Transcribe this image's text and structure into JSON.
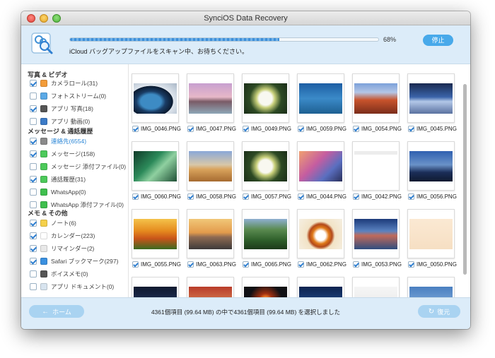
{
  "window": {
    "title": "SynciOS Data Recovery"
  },
  "header": {
    "progress_fraction": 0.68,
    "progress_text": "68%",
    "status": "iCloud バッグアップファイルをスキャン中、お待ちください。",
    "stop_label": "停止"
  },
  "sidebar": {
    "sections": [
      {
        "title": "写真 & ビデオ",
        "items": [
          {
            "label": "カメラロール(31)",
            "checked": true,
            "icon": "camera-roll-icon",
            "color": "#f39c3a"
          },
          {
            "label": "フォトストリーム(0)",
            "checked": false,
            "icon": "photo-stream-icon",
            "color": "#5aa9e6"
          },
          {
            "label": "アプリ 写真(18)",
            "checked": true,
            "icon": "app-photo-icon",
            "color": "#555555"
          },
          {
            "label": "アプリ 動画(0)",
            "checked": false,
            "icon": "app-video-icon",
            "color": "#3c7bc7"
          }
        ]
      },
      {
        "title": "メッセージ & 通話履歴",
        "items": [
          {
            "label": "連絡先(6554)",
            "checked": true,
            "active": true,
            "icon": "contacts-icon",
            "color": "#8a8a8a"
          },
          {
            "label": "メッセージ(158)",
            "checked": true,
            "icon": "messages-icon",
            "color": "#4cc95a"
          },
          {
            "label": "メッセージ 添付ファイル(0)",
            "checked": false,
            "icon": "message-attachment-icon",
            "color": "#4cc95a"
          },
          {
            "label": "通話履歴(31)",
            "checked": true,
            "icon": "call-history-icon",
            "color": "#4cc95a"
          },
          {
            "label": "WhatsApp(0)",
            "checked": false,
            "icon": "whatsapp-icon",
            "color": "#3fbf4e"
          },
          {
            "label": "WhatsApp 添付ファイル(0)",
            "checked": false,
            "icon": "whatsapp-attachment-icon",
            "color": "#3fbf4e"
          }
        ]
      },
      {
        "title": "メモ & その他",
        "items": [
          {
            "label": "ノート(6)",
            "checked": true,
            "icon": "notes-icon",
            "color": "#f5d04a"
          },
          {
            "label": "カレンダー(223)",
            "checked": true,
            "icon": "calendar-icon",
            "color": "#ffffff"
          },
          {
            "label": "リマインダー(2)",
            "checked": true,
            "icon": "reminders-icon",
            "color": "#e8e8e8"
          },
          {
            "label": "Safari ブックマーク(297)",
            "checked": true,
            "icon": "safari-bookmark-icon",
            "color": "#3a90e0"
          },
          {
            "label": "ボイスメモ(0)",
            "checked": false,
            "icon": "voice-memo-icon",
            "color": "#555555"
          },
          {
            "label": "アプリ ドキュメント(0)",
            "checked": false,
            "icon": "app-document-icon",
            "color": "#d8e4ef"
          }
        ]
      }
    ]
  },
  "thumbnails": [
    {
      "name": "IMG_0046.PNG",
      "checked": true,
      "style": "g-earth"
    },
    {
      "name": "IMG_0047.PNG",
      "checked": true,
      "style": "g-stone"
    },
    {
      "name": "IMG_0049.PNG",
      "checked": true,
      "style": "g-flower"
    },
    {
      "name": "IMG_0059.PNG",
      "checked": true,
      "style": "g-sea"
    },
    {
      "name": "IMG_0054.PNG",
      "checked": true,
      "style": "g-canyon"
    },
    {
      "name": "IMG_0045.PNG",
      "checked": true,
      "style": "g-mountain"
    },
    {
      "name": "IMG_0060.PNG",
      "checked": true,
      "style": "g-green"
    },
    {
      "name": "IMG_0058.PNG",
      "checked": true,
      "style": "g-dune"
    },
    {
      "name": "IMG_0057.PNG",
      "checked": true,
      "style": "g-flower"
    },
    {
      "name": "IMG_0044.PNG",
      "checked": true,
      "style": "g-ipad"
    },
    {
      "name": "IMG_0042.PNG",
      "checked": true,
      "style": "g-screen"
    },
    {
      "name": "IMG_0056.PNG",
      "checked": true,
      "style": "g-bridge"
    },
    {
      "name": "IMG_0055.PNG",
      "checked": true,
      "style": "g-tulip"
    },
    {
      "name": "IMG_0063.PNG",
      "checked": true,
      "style": "g-pier"
    },
    {
      "name": "IMG_0065.PNG",
      "checked": true,
      "style": "g-terrace"
    },
    {
      "name": "IMG_0062.PNG",
      "checked": true,
      "style": "g-cake"
    },
    {
      "name": "IMG_0053.PNG",
      "checked": true,
      "style": "g-lake"
    },
    {
      "name": "IMG_0050.PNG",
      "checked": true,
      "style": "g-card"
    },
    {
      "name": "",
      "checked": true,
      "style": "g-dark"
    },
    {
      "name": "",
      "checked": true,
      "style": "g-city"
    },
    {
      "name": "",
      "checked": true,
      "style": "g-fire"
    },
    {
      "name": "",
      "checked": true,
      "style": "g-navy"
    },
    {
      "name": "",
      "checked": true,
      "style": "g-white"
    },
    {
      "name": "",
      "checked": true,
      "style": "g-blue2"
    }
  ],
  "footer": {
    "home_label": "ホーム",
    "selection_text": "4361個項目 (99.64 MB) の中で4361個項目 (99.64 MB) を選択しました",
    "restore_label": "復元"
  }
}
